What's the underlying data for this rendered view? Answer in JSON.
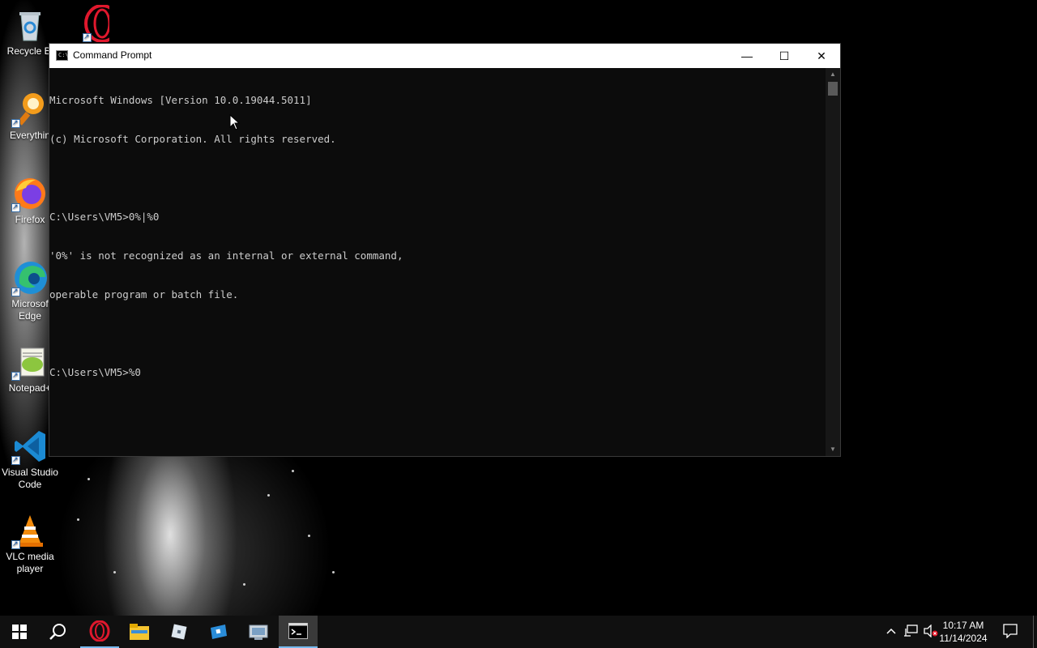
{
  "desktop": {
    "icons": [
      {
        "label": "Recycle Bi",
        "icon": "recycle-bin-icon"
      },
      {
        "label": "",
        "icon": "opera-icon"
      },
      {
        "label": "Everythin",
        "icon": "everything-search-icon"
      },
      {
        "label": "Firefox",
        "icon": "firefox-icon"
      },
      {
        "label": "Microsof Edge",
        "icon": "edge-icon"
      },
      {
        "label": "Notepad+",
        "icon": "notepad-plus-plus-icon"
      },
      {
        "label": "Visual Studio Code",
        "icon": "vscode-icon"
      },
      {
        "label": "VLC media player",
        "icon": "vlc-icon"
      }
    ]
  },
  "window": {
    "title": "Command Prompt",
    "icon_text": "C:\\",
    "minimize_glyph": "—",
    "maximize_glyph": "☐",
    "close_glyph": "✕",
    "console_lines": [
      "Microsoft Windows [Version 10.0.19044.5011]",
      "(c) Microsoft Corporation. All rights reserved.",
      "",
      "C:\\Users\\VM5>0%|%0",
      "'0%' is not recognized as an internal or external command,",
      "operable program or batch file.",
      "",
      "C:\\Users\\VM5>%0"
    ]
  },
  "taskbar": {
    "apps": [
      "start-icon",
      "search-icon",
      "opera-icon",
      "file-explorer-icon",
      "roblox-studio-icon",
      "roblox-icon",
      "control-panel-icon",
      "command-prompt-icon"
    ],
    "clock_time": "10:17 AM",
    "clock_date": "11/14/2024"
  },
  "colors": {
    "console_bg": "#0c0c0c",
    "console_text": "#cccccc",
    "taskbar_bg": "#101010",
    "accent": "#76b9ed"
  }
}
